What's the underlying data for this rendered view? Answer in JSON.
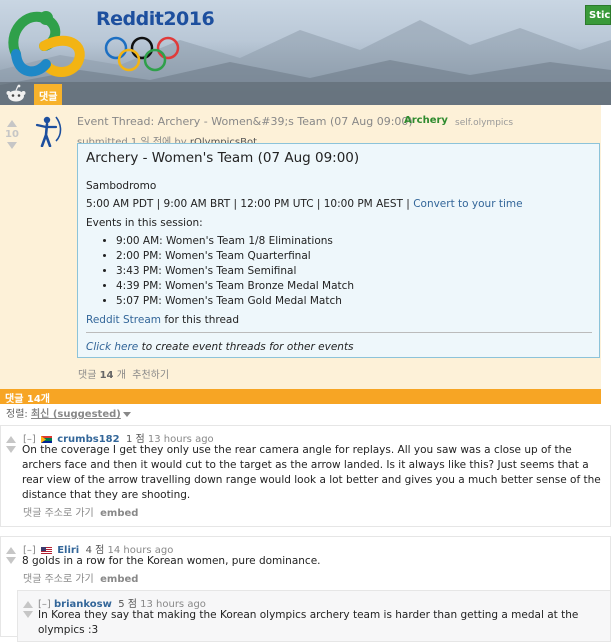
{
  "header": {
    "logo_text": "Reddit2016",
    "stick_label": "Stic",
    "active_tab": "댓글"
  },
  "post": {
    "score": "10",
    "title": "Event Thread: Archery - Women&#39;s Team (07 Aug 09:00)",
    "flair": "Archery",
    "domain": "self.olympics",
    "submitted_prefix": "submitted 1 일 전에 by ",
    "author": "rOlympicsBot",
    "selftext": {
      "heading": "Archery - Women's Team (07 Aug 09:00)",
      "venue": "Sambodromo",
      "times": "5:00 AM PDT | 9:00 AM BRT | 12:00 PM UTC | 10:00 PM AEST | ",
      "convert_link": "Convert to your time",
      "events_label": "Events in this session:",
      "events": [
        "9:00 AM: Women's Team 1/8 Eliminations",
        "2:00 PM: Women's Team Quarterfinal",
        "3:43 PM: Women's Team Semifinal",
        "4:39 PM: Women's Team Bronze Medal Match",
        "5:07 PM: Women's Team Gold Medal Match"
      ],
      "stream_link": "Reddit Stream",
      "stream_suffix": " for this thread",
      "click_link": "Click here",
      "click_suffix": " to create event threads for other events"
    },
    "actions": {
      "comments_prefix": "댓글 ",
      "comments_count": "14",
      "comments_suffix": " 개",
      "recommend": "추천하기"
    }
  },
  "comments_bar": "댓글 14개",
  "sort": {
    "label": "정렬:",
    "value": "최신 (suggested)"
  },
  "comments": [
    {
      "toggle": "[–]",
      "author": "crumbs182",
      "points": "1 점",
      "time": "13 hours ago",
      "body": "On the coverage I get they only use the rear camera angle for replays. All you saw was a close up of the archers face and then it would cut to the target as the arrow landed. Is it always like this? Just seems that a rear view of the arrow travelling down range would look a lot better and gives you a much better sense of the distance that they are shooting.",
      "action_link": "댓글 주소로 가기",
      "action_embed": "embed"
    },
    {
      "toggle": "[–]",
      "author": "Eliri",
      "points": "4 점",
      "time": "14 hours ago",
      "body": "8 golds in a row for the Korean women, pure dominance.",
      "action_link": "댓글 주소로 가기",
      "action_embed": "embed"
    },
    {
      "toggle": "[–]",
      "author": "briankosw",
      "points": "5 점",
      "time": "13 hours ago",
      "body": "In Korea they say that making the Korean olympics archery team is harder than getting a medal at the olympics :3"
    }
  ],
  "colors": {
    "accent_orange": "#f7a524",
    "post_bg": "#fdf1d8",
    "selftext_bg": "#eef7fb",
    "link_blue": "#336699",
    "flair_green": "#2e8b2e"
  }
}
